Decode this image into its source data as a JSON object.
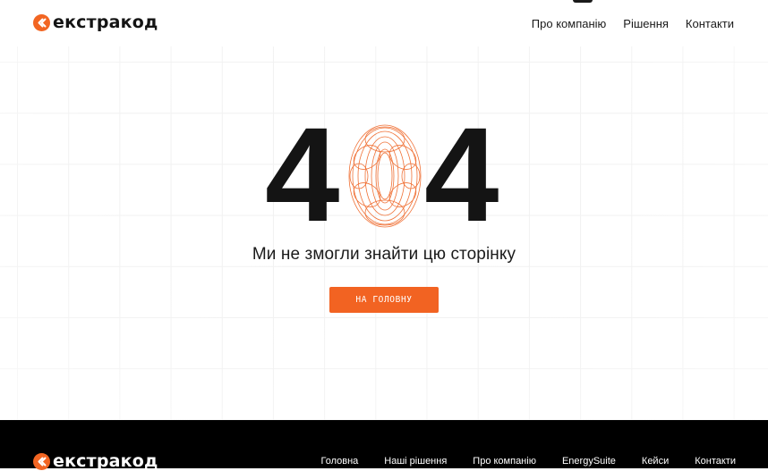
{
  "brand": {
    "name": "екстракод",
    "accent": "#f26522"
  },
  "header": {
    "nav": [
      "Про компанію",
      "Рішення",
      "Контакти"
    ]
  },
  "error_page": {
    "code_left": "4",
    "code_right": "4",
    "message": "Ми не змогли знайти цю сторінку",
    "button_label": "НА ГОЛОВНУ"
  },
  "footer": {
    "nav": [
      "Головна",
      "Наші рішення",
      "Про компанію",
      "EnergySuite",
      "Кейси",
      "Контакти"
    ]
  },
  "colors": {
    "background": "#ffffff",
    "text": "#141414",
    "accent": "#f26522",
    "footer_bg": "#000000"
  }
}
